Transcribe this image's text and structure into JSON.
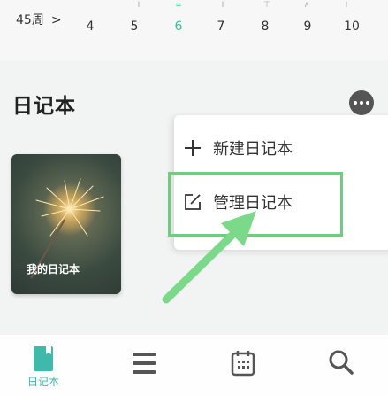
{
  "week": {
    "label": "45周",
    "chevron": ">",
    "days": [
      "4",
      "5",
      "6",
      "7",
      "8",
      "9",
      "10"
    ],
    "today_index": 2,
    "weekday_marks": [
      "I",
      "I",
      "=",
      "⊤",
      "∧",
      "I"
    ]
  },
  "page": {
    "title": "日记本"
  },
  "notebook": {
    "title": "我的日记本"
  },
  "menu": {
    "new_label": "新建日记本",
    "manage_label": "管理日记本"
  },
  "tabbar": {
    "diary_label": "日记本",
    "icons": [
      "notebook-icon",
      "list-icon",
      "calendar-icon",
      "search-icon"
    ]
  },
  "colors": {
    "accent": "#35c39a",
    "tab_active": "#3fb9a9",
    "highlight": "#6dcf7d"
  }
}
